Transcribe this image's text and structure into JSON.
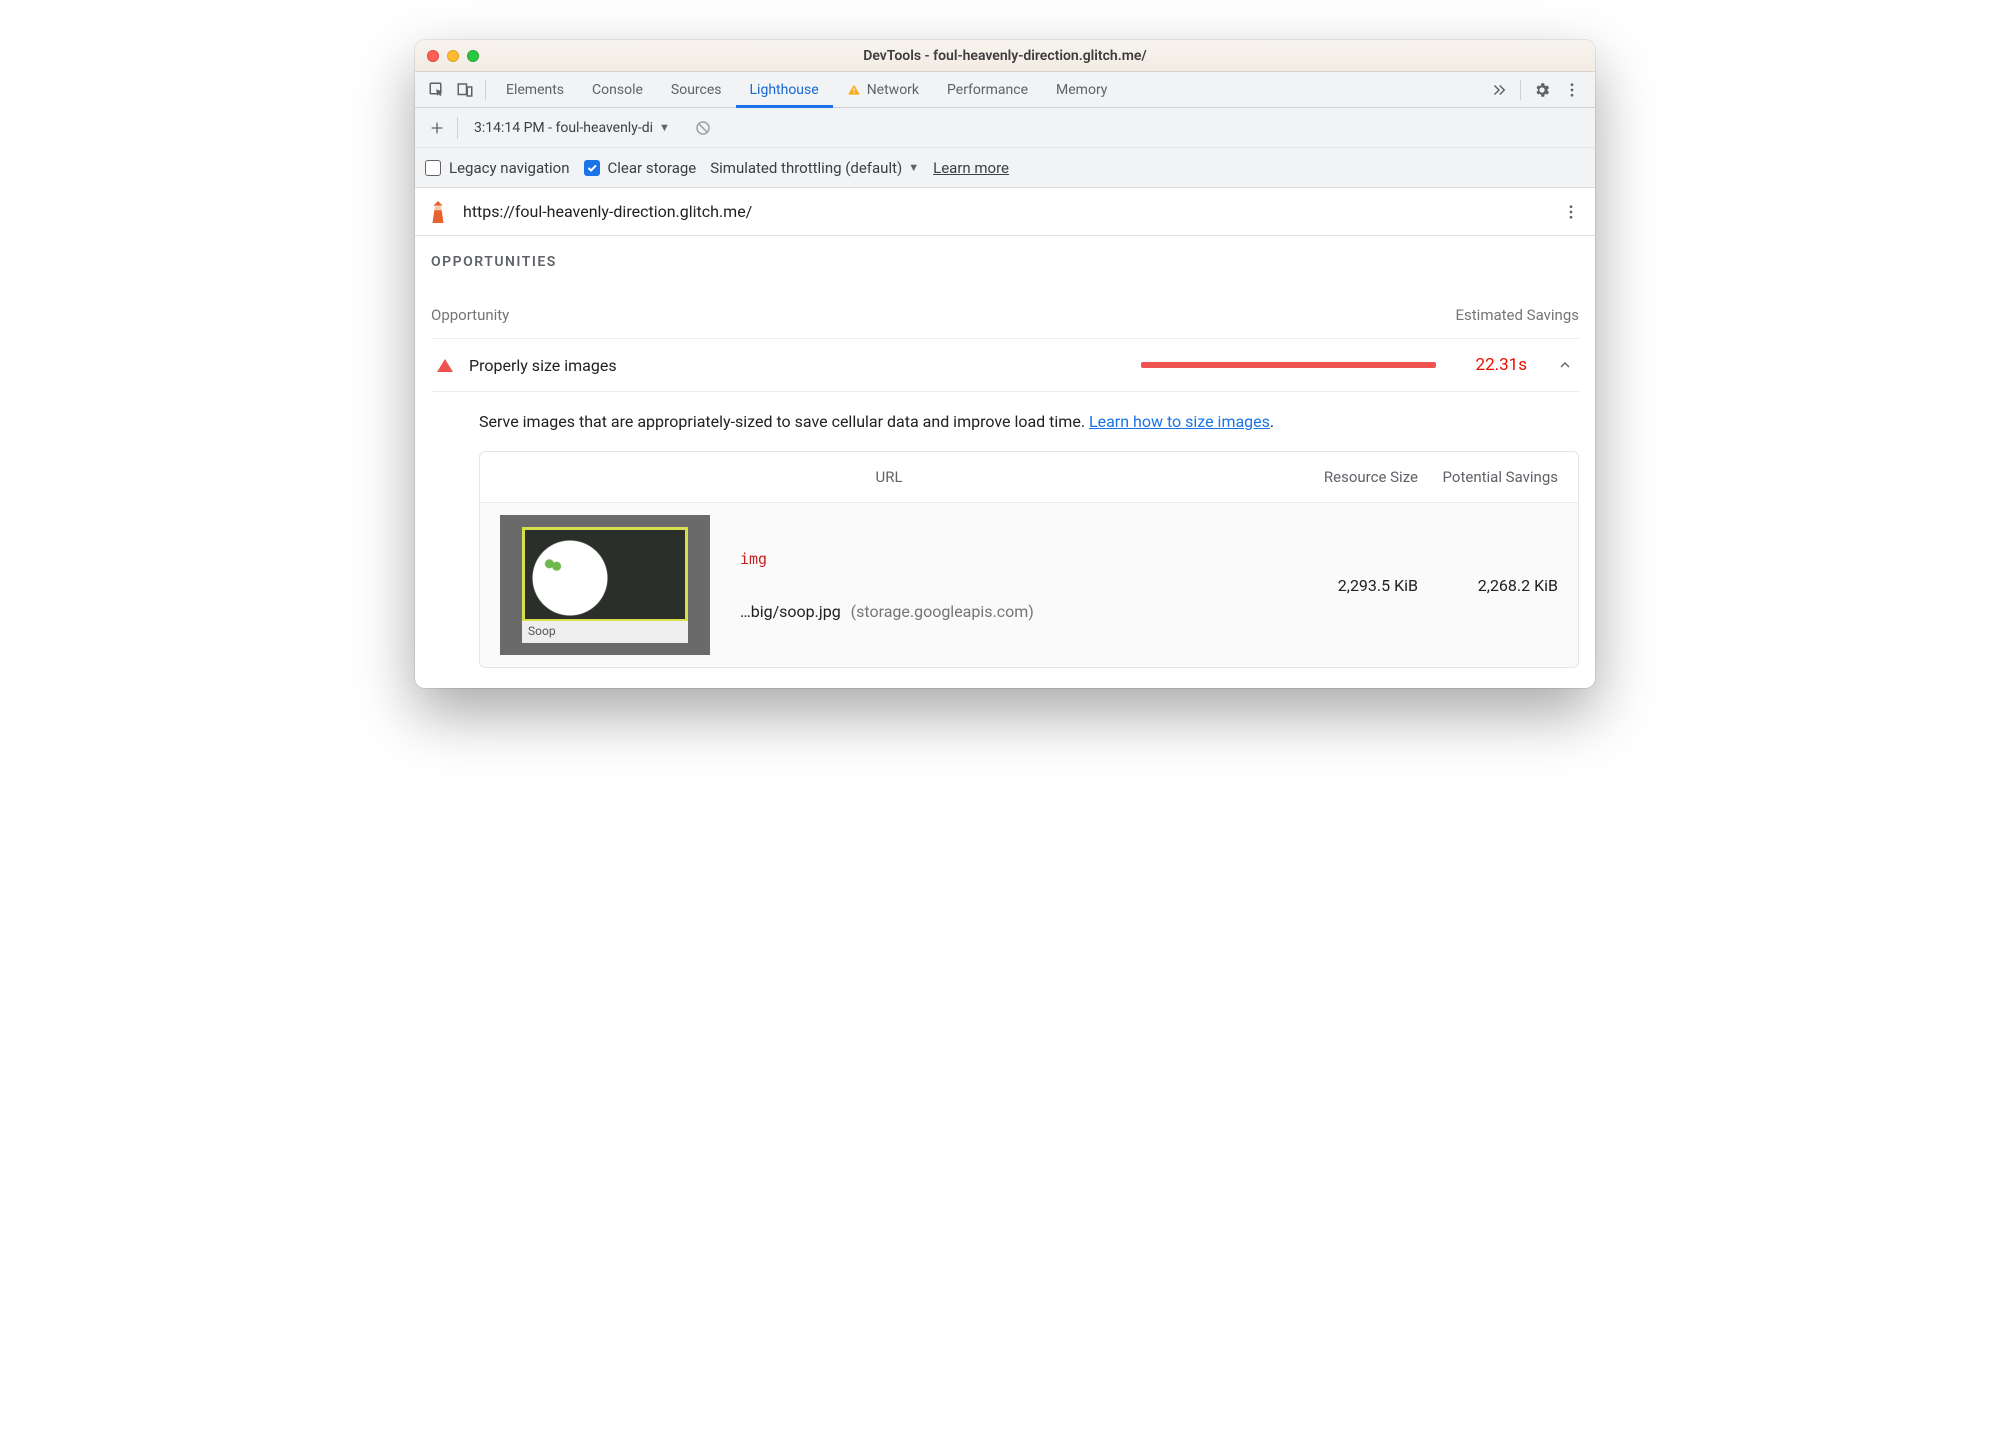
{
  "window": {
    "title": "DevTools - foul-heavenly-direction.glitch.me/"
  },
  "tabs": {
    "items": [
      "Elements",
      "Console",
      "Sources",
      "Lighthouse",
      "Network",
      "Performance",
      "Memory"
    ],
    "active": "Lighthouse",
    "warning_on": "Network"
  },
  "runbar": {
    "selected_run": "3:14:14 PM - foul-heavenly-di"
  },
  "options": {
    "legacy_label": "Legacy navigation",
    "legacy_checked": false,
    "clear_label": "Clear storage",
    "clear_checked": true,
    "throttling_label": "Simulated throttling (default)",
    "learn_more": "Learn more"
  },
  "url_row": {
    "url": "https://foul-heavenly-direction.glitch.me/"
  },
  "opportunities": {
    "section_title": "OPPORTUNITIES",
    "col_opportunity": "Opportunity",
    "col_savings": "Estimated Savings",
    "items": [
      {
        "name": "Properly size images",
        "savings": "22.31s",
        "description": "Serve images that are appropriately-sized to save cellular data and improve load time. ",
        "link_text": "Learn how to size images",
        "period": "."
      }
    ]
  },
  "table": {
    "head_url": "URL",
    "head_size": "Resource Size",
    "head_savings": "Potential Savings",
    "rows": [
      {
        "tag": "img",
        "path": "…big/soop.jpg",
        "host": "(storage.googleapis.com)",
        "size": "2,293.5 KiB",
        "savings": "2,268.2 KiB",
        "thumb_caption": "Soop"
      }
    ]
  }
}
